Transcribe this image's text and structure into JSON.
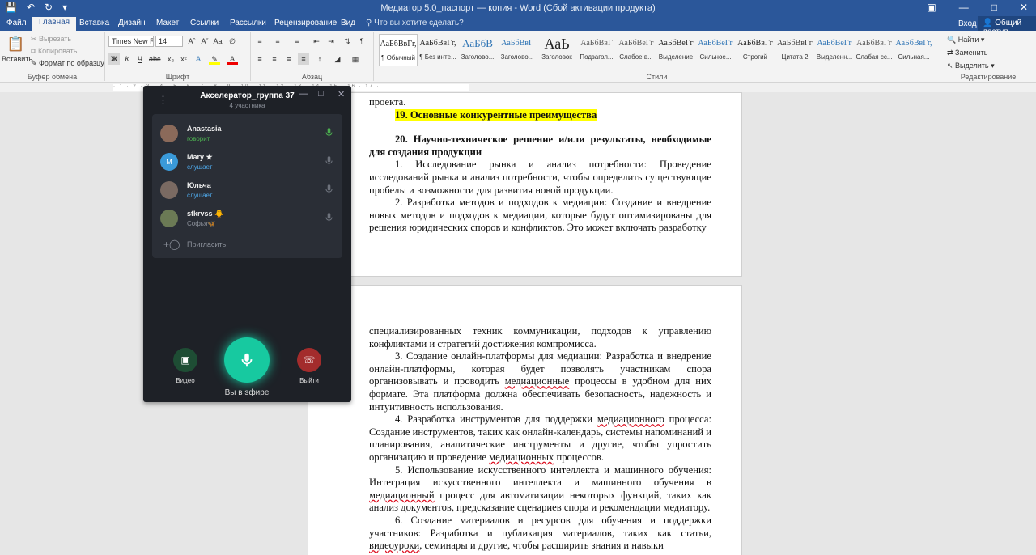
{
  "window": {
    "title": "Медиатор 5.0_паспорт — копия - Word (Сбой активации продукта)"
  },
  "tabs": [
    "Файл",
    "Главная",
    "Вставка",
    "Дизайн",
    "Макет",
    "Ссылки",
    "Рассылки",
    "Рецензирование",
    "Вид"
  ],
  "tell_me": "Что вы хотите сделать?",
  "signin": "Вход",
  "share": "Общий доступ",
  "ribbon": {
    "paste": "Вставить",
    "cut": "Вырезать",
    "copy": "Копировать",
    "format_painter": "Формат по образцу",
    "clipboard_group": "Буфер обмена",
    "font_name": "Times New R",
    "font_size": "14",
    "font_group": "Шрифт",
    "paragraph_group": "Абзац",
    "styles_group": "Стили",
    "find": "Найти",
    "replace": "Заменить",
    "select": "Выделить",
    "editing_group": "Редактирование",
    "styles": [
      {
        "preview": "АаБбВвГг,",
        "name": "¶ Обычный",
        "color": "#222222"
      },
      {
        "preview": "АаБбВвГг,",
        "name": "¶ Без инте...",
        "color": "#222222"
      },
      {
        "preview": "АаБбВ",
        "name": "Заголово...",
        "color": "#2e74b5"
      },
      {
        "preview": "АаБбВвГ",
        "name": "Заголово...",
        "color": "#2e74b5"
      },
      {
        "preview": "АаЬ",
        "name": "Заголовок",
        "color": "#222222"
      },
      {
        "preview": "АаБбВвГ",
        "name": "Подзагол...",
        "color": "#595959"
      },
      {
        "preview": "АаБбВеГг",
        "name": "Слабое в...",
        "color": "#595959"
      },
      {
        "preview": "АаБбВеГг",
        "name": "Выделение",
        "color": "#222222"
      },
      {
        "preview": "АаБбВеГг",
        "name": "Сильное...",
        "color": "#2e74b5"
      },
      {
        "preview": "АаБбВвГг",
        "name": "Строгий",
        "color": "#222222"
      },
      {
        "preview": "АаБбВвГг",
        "name": "Цитата 2",
        "color": "#404040"
      },
      {
        "preview": "АаБбВеГг",
        "name": "Выделенн...",
        "color": "#2e74b5"
      },
      {
        "preview": "АаБбВвГг",
        "name": "Слабая сс...",
        "color": "#595959"
      },
      {
        "preview": "АаБбВвГг,",
        "name": "Сильная...",
        "color": "#2e74b5"
      }
    ]
  },
  "document": {
    "page1": {
      "top_line": "проекта.",
      "heading19": "19. Основные конкурентные преимущества",
      "heading20": "20. Научно-техническое решение и/или результаты, необходимые для создания продукции",
      "para1": "1. Исследование рынка и анализ потребности: Проведение исследований рынка и анализ потребности, чтобы определить существующие пробелы и возможности для развития новой продукции.",
      "para2": "2. Разработка методов и подходов к медиации: Создание и внедрение новых методов и подходов к медиации, которые будут оптимизированы для решения юридических споров и конфликтов. Это может включать разработку"
    },
    "page2": {
      "para_cont": "специализированных техник коммуникации, подходов к управлению конфликтами и стратегий достижения компромисса.",
      "p3_a": "3. Создание онлайн-платформы для медиации: Разработка и внедрение онлайн-платформы, которая будет позволять участникам спора организовывать и проводить ",
      "p3_sq": "медиационные",
      "p3_b": " процессы в удобном для них формате. Эта платформа должна обеспечивать безопасность, надежность и интуитивность использования.",
      "p4_a": "4. Разработка инструментов для поддержки ",
      "p4_sq": "медиационного",
      "p4_b": " процесса: Создание инструментов, таких как онлайн-календарь, системы напоминаний и планирования, аналитические инструменты и другие, чтобы упростить организацию и проведение ",
      "p4_sq2": "медиационных",
      "p4_c": " процессов.",
      "p5_a": "5. Использование искусственного интеллекта и машинного обучения: Интеграция искусственного интеллекта и машинного обучения в ",
      "p5_sq": "медиационный",
      "p5_b": " процесс для автоматизации некоторых функций, таких как анализ документов, предсказание сценариев спора и рекомендации медиатору.",
      "p6_a": "6. Создание материалов и ресурсов для обучения и поддержки участников: Разработка и публикация материалов, таких как статьи, ",
      "p6_sq": "видеоуроки",
      "p6_b": ", семинары и другие, чтобы расширить знания и навыки"
    }
  },
  "call": {
    "title": "Акселератор_группа 37",
    "subtitle": "4 участника",
    "participants": [
      {
        "name": "Anastasia",
        "status": "говорит",
        "status_color": "#4caf50",
        "avatar_color": "#8b6a5a",
        "initial": ""
      },
      {
        "name": "Mary ★",
        "status": "слушает",
        "status_color": "#4ea7e8",
        "avatar_color": "#3a9ad9",
        "initial": "M"
      },
      {
        "name": "Юльча",
        "status": "слушает",
        "status_color": "#4ea7e8",
        "avatar_color": "#7a6a62",
        "initial": ""
      },
      {
        "name": "stkrvss 🐥",
        "status": "Софья🦋",
        "status_color": "#8a8f99",
        "avatar_color": "#6b7a55",
        "initial": ""
      }
    ],
    "invite": "Пригласить",
    "video_label": "Видео",
    "on_air_label": "Вы в эфире",
    "leave_label": "Выйти"
  }
}
